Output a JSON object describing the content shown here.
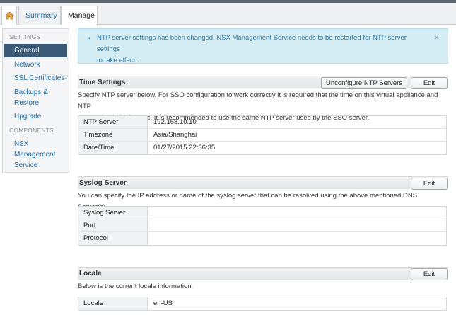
{
  "tabs": {
    "home_icon": "home-icon",
    "summary": "Summary",
    "manage": "Manage"
  },
  "sidebar": {
    "settings_heading": "SETTINGS",
    "items": [
      "General",
      "Network",
      "SSL Certificates",
      "Backups &",
      "Restore",
      "Upgrade"
    ],
    "components_heading": "COMPONENTS",
    "component_lines": [
      "NSX",
      "Management",
      "Service"
    ]
  },
  "notice": {
    "line1": "NTP server settings has been changed. NSX Management Service needs to be restarted for NTP server settings",
    "line2": "to take effect.",
    "close": "×"
  },
  "time_settings": {
    "title": "Time Settings",
    "unconfigure_label": "Unconfigure NTP Servers",
    "edit_label": "Edit",
    "desc_line1": "Specify NTP server below. For SSO configuration to work correctly it is required that the time on this virtual appliance and NTP",
    "desc_line2": "server should be in sync. It is recommended to use the same NTP server used by the SSO server.",
    "rows": [
      {
        "label": "NTP Server",
        "value": "192.168.10.10"
      },
      {
        "label": "Timezone",
        "value": "Asia/Shanghai"
      },
      {
        "label": "Date/Time",
        "value": "01/27/2015 22:36:35"
      }
    ]
  },
  "syslog": {
    "title": "Syslog Server",
    "edit_label": "Edit",
    "desc": "You can specify the IP address or name of the syslog server that can be resolved using the above mentioned DNS Server(s).",
    "rows": [
      {
        "label": "Syslog Server",
        "value": ""
      },
      {
        "label": "Port",
        "value": ""
      },
      {
        "label": "Protocol",
        "value": ""
      }
    ]
  },
  "locale": {
    "title": "Locale",
    "edit_label": "Edit",
    "desc": "Below is the current locale information.",
    "rows": [
      {
        "label": "Locale",
        "value": "en-US"
      }
    ]
  }
}
